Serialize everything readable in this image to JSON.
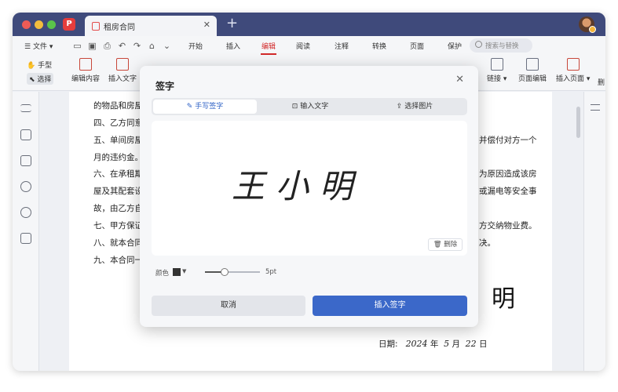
{
  "titlebar": {
    "app_logo": "P",
    "tab_title": "租房合同",
    "tab_close": "✕",
    "new_tab": "+"
  },
  "menubar": {
    "file_label": "文件",
    "tabs": [
      "开始",
      "插入",
      "编辑",
      "阅读",
      "注释",
      "转换",
      "页面",
      "保护"
    ],
    "active_tab": "编辑",
    "search_placeholder": "搜索与替换"
  },
  "ribbon": {
    "hand_tool": "手型",
    "select_tool": "选择",
    "items_left": [
      "编辑内容",
      "插入文字"
    ],
    "items_right": [
      "链接",
      "页面编辑",
      "插入页面",
      "删"
    ]
  },
  "document": {
    "lines": [
      "的物品和房屋",
      "四、乙方同意",
      "五、单间房屋",
      "月的违约金。",
      "六、在承租期",
      "屋及其配套设",
      "故，由乙方自",
      "七、甲方保证",
      "八、就本合同",
      "九、本合同一"
    ],
    "right_fragments": [
      "并偿付对方一个",
      "为原因造成该房",
      "或漏电等安全事",
      "方交纳物业费。",
      "决。"
    ],
    "signature_fragment": "明",
    "date_label": "日期:",
    "date_year": "2024",
    "date_year_unit": "年",
    "date_month": "5",
    "date_month_unit": "月",
    "date_day": "22",
    "date_day_unit": "日"
  },
  "dialog": {
    "title": "签字",
    "close": "✕",
    "tabs": [
      "手写签字",
      "输入文字",
      "选择图片"
    ],
    "active_tab": "手写签字",
    "handwriting": "王小明",
    "delete_label": "删除",
    "color_label": "颜色",
    "stroke_color": "#333333",
    "stroke_size": "5pt",
    "stroke_level": 0.35,
    "cancel_label": "取消",
    "insert_label": "插入签字"
  },
  "colors": {
    "accent": "#3b68c9",
    "active_menu": "#d22a2a",
    "titlebar": "#3f4a7b"
  }
}
